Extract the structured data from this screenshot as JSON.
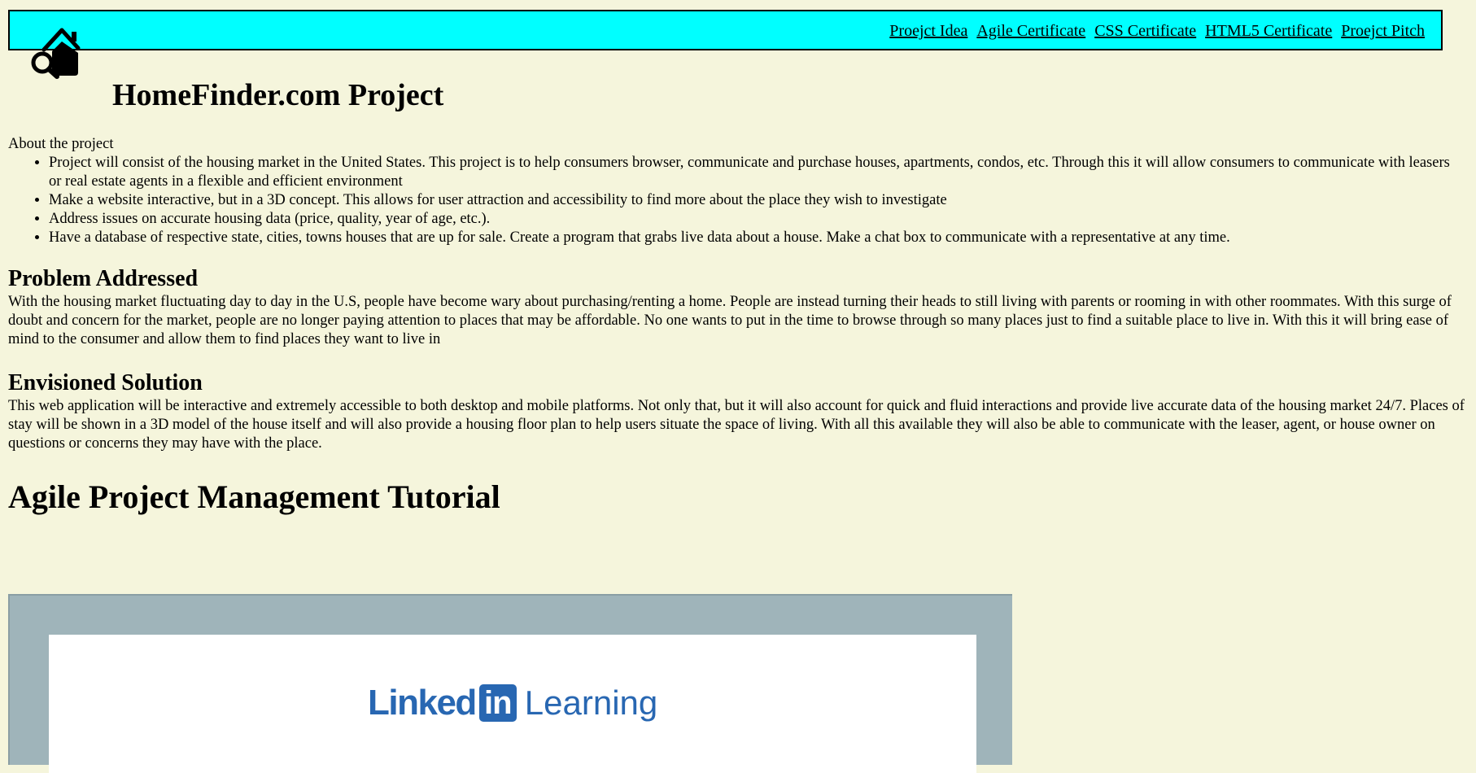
{
  "nav": {
    "links": [
      "Proejct Idea",
      "Agile Certificate",
      "CSS Certificate",
      "HTML5 Certificate",
      "Proejct Pitch"
    ]
  },
  "logo": {
    "icon": "house-search-icon"
  },
  "page_title": "HomeFinder.com Project",
  "about_label": "About the project",
  "bullets": [
    "Project will consist of the housing market in the United States. This project is to help consumers browser, communicate and purchase houses, apartments, condos, etc. Through this it will allow consumers to communicate with leasers or real estate agents in a flexible and efficient environment",
    "Make a website interactive, but in a 3D concept. This allows for user attraction and accessibility to find more about the place they wish to investigate",
    "Address issues on accurate housing data (price, quality, year of age, etc.).",
    "Have a database of respective state, cities, towns houses that are up for sale. Create a program that grabs live data about a house. Make a chat box to communicate with a representative at any time."
  ],
  "problem": {
    "heading": "Problem Addressed",
    "text": "With the housing market fluctuating day to day in the U.S, people have become wary about purchasing/renting a home. People are instead turning their heads to still living with parents or rooming in with other roommates. With this surge of doubt and concern for the market, people are no longer paying attention to places that may be affordable. No one wants to put in the time to browse through so many places just to find a suitable place to live in. With this it will bring ease of mind to the consumer and allow them to find places they want to live in"
  },
  "solution": {
    "heading": "Envisioned Solution",
    "text": "This web application will be interactive and extremely accessible to both desktop and mobile platforms. Not only that, but it will also account for quick and fluid interactions and provide live accurate data of the housing market 24/7. Places of stay will be shown in a 3D model of the house itself and will also provide a housing floor plan to help users situate the space of living. With all this available they will also be able to communicate with the leaser, agent, or house owner on questions or concerns they may have with the place."
  },
  "tutorial": {
    "heading": "Agile Project Management Tutorial",
    "brand_name": "Linked",
    "brand_box": "in",
    "brand_product": "Learning"
  },
  "colors": {
    "page_bg": "#f5f5dc",
    "nav_bg": "#00ffff",
    "video_frame": "#9fb4ba",
    "linkedin_blue": "#2867b2"
  }
}
